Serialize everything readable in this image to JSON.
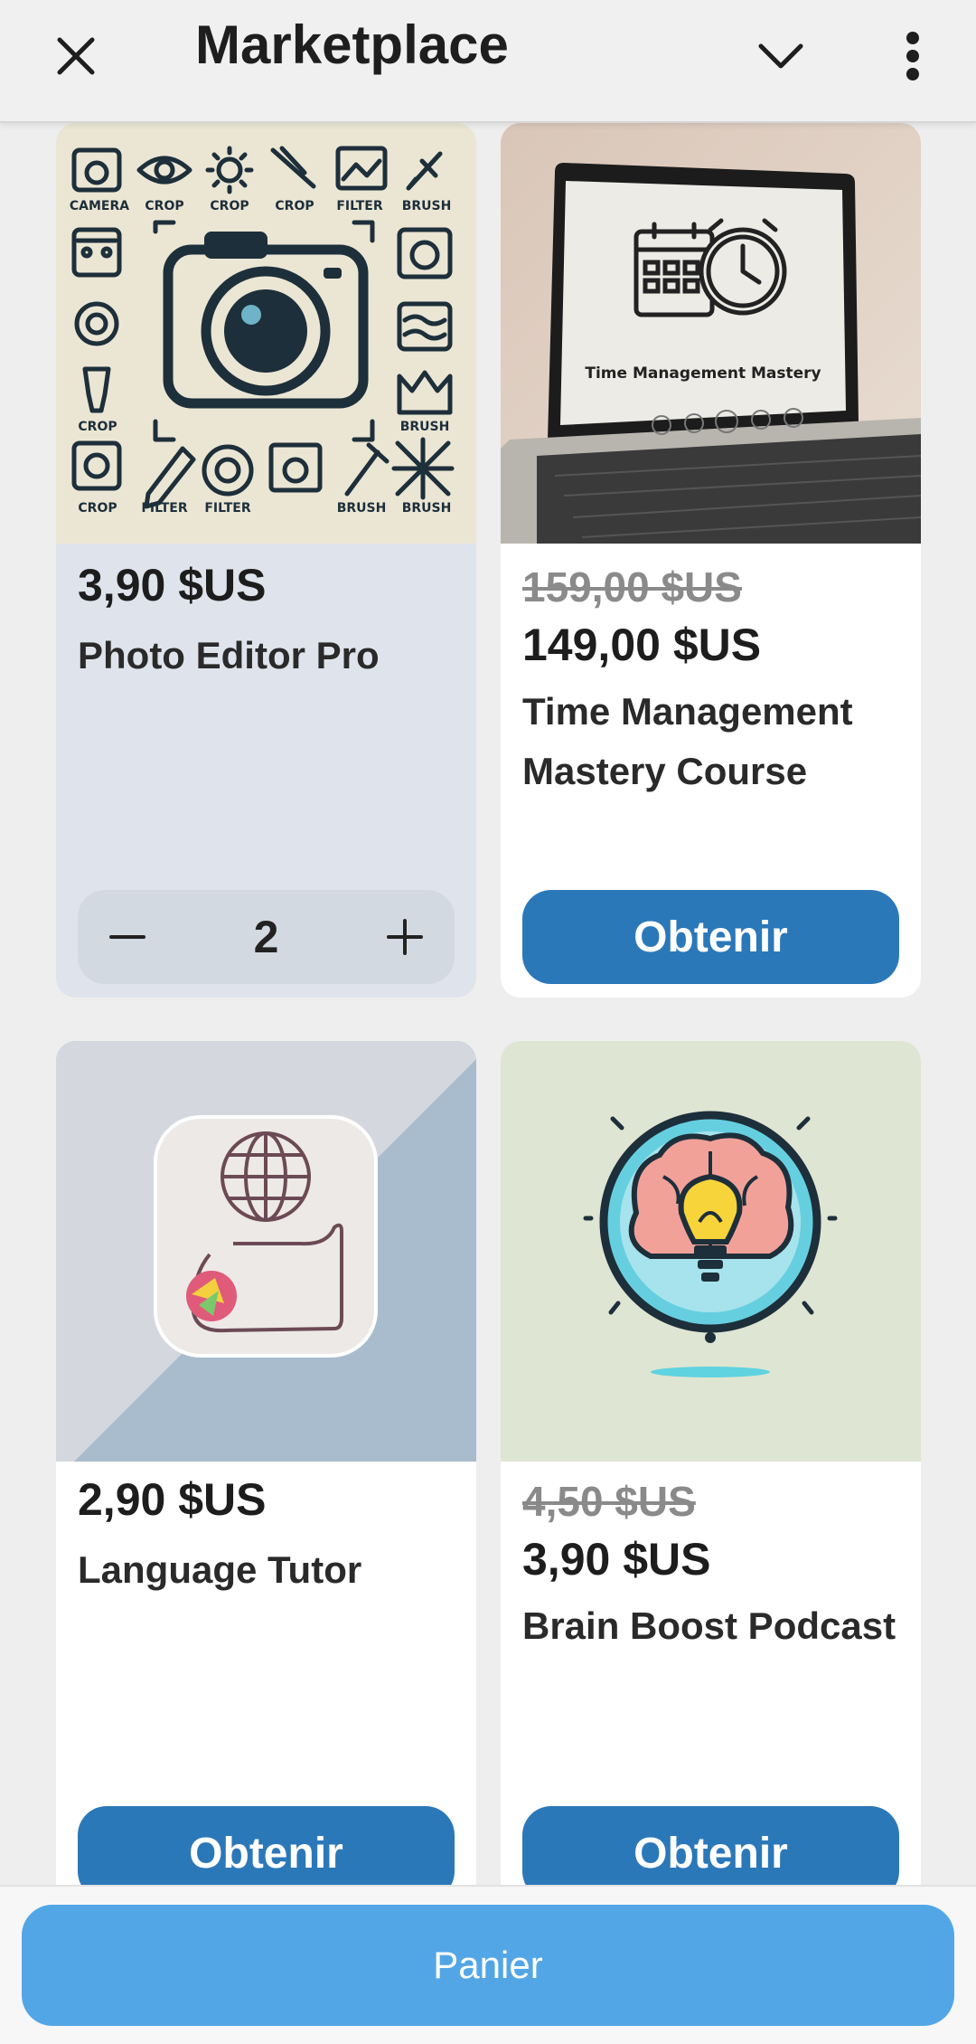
{
  "header": {
    "title": "Marketplace",
    "close_icon": "close-icon",
    "collapse_icon": "chevron-down-icon",
    "more_icon": "more-vert-icon"
  },
  "products": [
    {
      "name": "Photo Editor Pro",
      "price": "3,90 $US",
      "old_price": "",
      "quantity": "2",
      "in_cart": true,
      "thumbnail_text": [
        "CAMERA",
        "CROP",
        "CROP",
        "CROP",
        "FILTER",
        "BRUSH",
        "CROP",
        "BRUSH",
        "CROP",
        "FILTER",
        "FILTER",
        "BRUSH",
        "BRUSH"
      ]
    },
    {
      "name": "Time Management Mastery Course",
      "price": "149,00 $US",
      "old_price": "159,00 $US",
      "button": "Obtenir",
      "in_cart": false,
      "thumbnail_text": [
        "Time Management Mastery"
      ]
    },
    {
      "name": "Language Tutor",
      "price": "2,90 $US",
      "old_price": "",
      "button": "Obtenir",
      "in_cart": false
    },
    {
      "name": "Brain Boost Podcast",
      "price": "3,90 $US",
      "old_price": "4,50 $US",
      "button": "Obtenir",
      "in_cart": false
    }
  ],
  "stepper": {
    "minus_icon": "minus-icon",
    "plus_icon": "plus-icon"
  },
  "footer": {
    "cart_label": "Panier"
  },
  "colors": {
    "primary_button": "#2b78b9",
    "cart_button": "#53a6e6",
    "selected_card": "#dfe4ec"
  }
}
